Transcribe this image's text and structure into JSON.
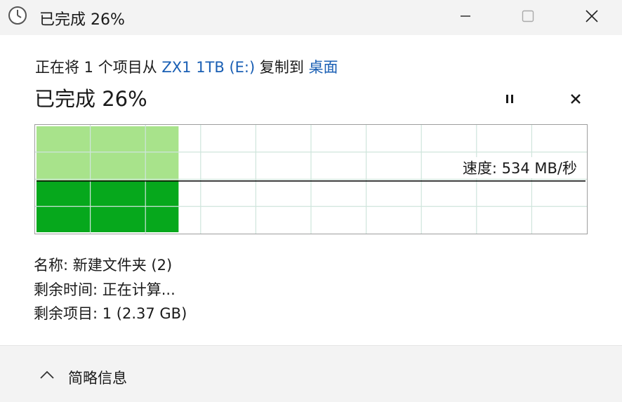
{
  "window": {
    "title": "已完成 26%",
    "icons": {
      "app": "clock-icon",
      "minimize": "minimize-icon",
      "maximize": "maximize-icon",
      "close": "close-icon"
    }
  },
  "copy": {
    "prefix": "正在将 1 个项目从 ",
    "source": "ZX1 1TB (E:)",
    "middle": " 复制到 ",
    "destination": "桌面",
    "progress_text": "已完成 26%",
    "progress_fraction": 0.26,
    "pause_icon": "pause-icon",
    "cancel_icon": "cancel-icon"
  },
  "graph": {
    "speed_text": "速度: 534 MB/秒",
    "colors": {
      "transferred": "#06a81c",
      "transferred_light": "#a8e38b",
      "grid": "#cfe5dc",
      "speed_line": "#000000"
    }
  },
  "details": {
    "name": "名称: 新建文件夹 (2)",
    "time_remaining": "剩余时间: 正在计算...",
    "items_remaining": "剩余项目: 1 (2.37 GB)"
  },
  "footer": {
    "toggle_label": "简略信息",
    "toggle_icon": "chevron-up-icon"
  }
}
